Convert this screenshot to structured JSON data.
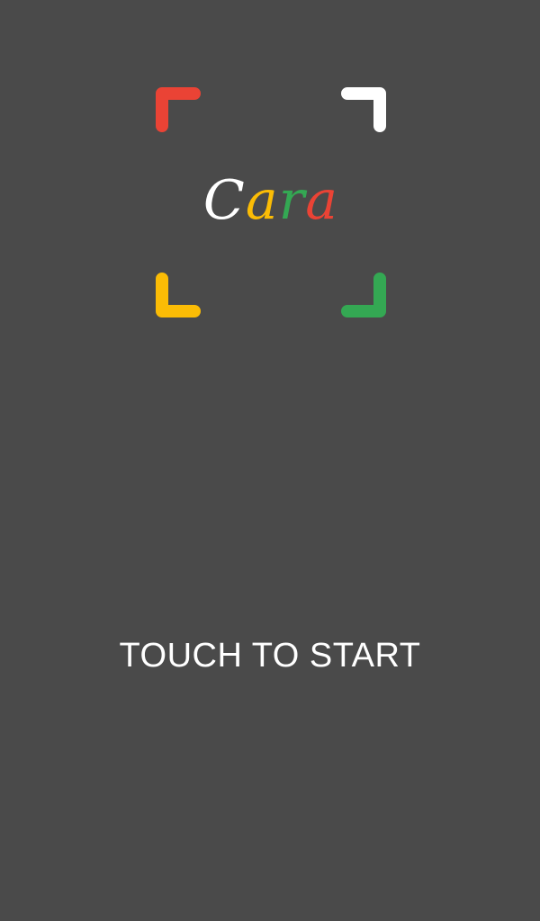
{
  "app": {
    "logo_letters": [
      {
        "char": "C",
        "color": "#ffffff"
      },
      {
        "char": "a",
        "color": "#fbbc05"
      },
      {
        "char": "r",
        "color": "#34a853"
      },
      {
        "char": "a",
        "color": "#ea4335"
      }
    ],
    "corner_colors": {
      "top_left": "#ea4335",
      "top_right": "#ffffff",
      "bottom_left": "#fbbc05",
      "bottom_right": "#34a853"
    },
    "background": "#4a4a4a"
  },
  "start_prompt": {
    "label": "TOUCH TO START"
  }
}
